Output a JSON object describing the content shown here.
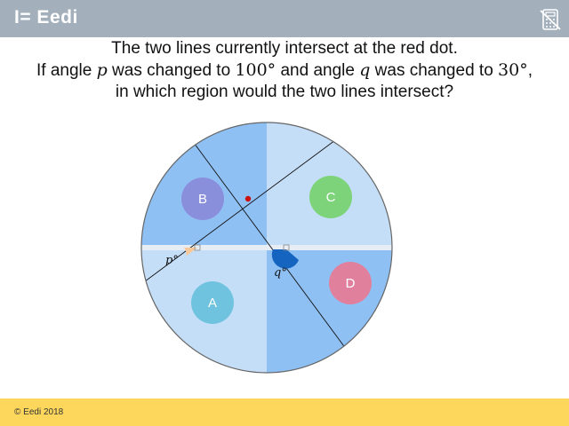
{
  "header": {
    "logo_text": "I= Eedi",
    "calculator_icon": "calculator-crossed-icon"
  },
  "question": {
    "line1": "The two lines currently intersect at the red dot.",
    "line2_pre": "If angle ",
    "p": "p",
    "line2_mid1": " was changed to ",
    "p_value": "100°",
    "line2_mid2": " and angle ",
    "q": "q",
    "line2_mid3": " was changed to ",
    "q_value": "30°",
    "line2_post": ",",
    "line3": "in which region would the two lines intersect?"
  },
  "diagram": {
    "regions": [
      {
        "label": "A",
        "color": "#6fc3df"
      },
      {
        "label": "B",
        "color": "#8a8fdc"
      },
      {
        "label": "C",
        "color": "#7dd37a"
      },
      {
        "label": "D",
        "color": "#e0809d"
      }
    ],
    "angle_p_label": "p°",
    "angle_q_label": "q°",
    "colors": {
      "light_blue": "#c5def8",
      "mid_blue": "#8fc0f4",
      "intersection_dot": "#cc1111",
      "angle_p": "#f6c89a",
      "angle_q": "#1564c0"
    }
  },
  "footer": {
    "copyright": "© Eedi 2018"
  }
}
